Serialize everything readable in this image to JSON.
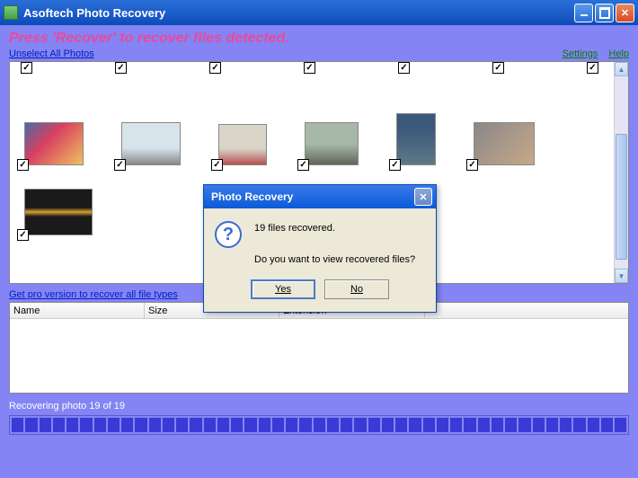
{
  "window": {
    "title": "Asoftech Photo Recovery"
  },
  "main": {
    "tagline": "Press 'Recover' to recover files detected.",
    "unselect_link": "Unselect All Photos",
    "settings_link": "Settings",
    "help_link": "Help",
    "pro_link": "Get pro version to recover all file types"
  },
  "table": {
    "headers": [
      "Name",
      "Size",
      "Extension"
    ]
  },
  "status": {
    "text": "Recovering photo 19 of 19",
    "progress_percent": 100,
    "segments": 45
  },
  "dialog": {
    "title": "Photo Recovery",
    "line1": "19 files recovered.",
    "line2": "Do you want to view recovered files?",
    "yes": "Yes",
    "no": "No"
  },
  "thumbs_row1_count": 6,
  "thumbs_row2_count": 1,
  "checkbox_row_count": 7
}
